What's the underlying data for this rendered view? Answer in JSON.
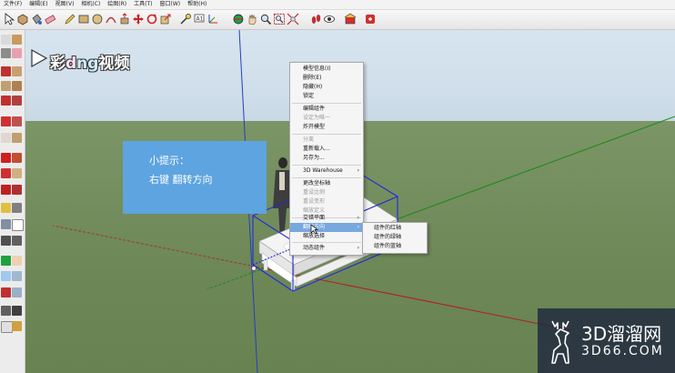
{
  "menubar": {
    "items": [
      "文件(F)",
      "编辑(E)",
      "视图(V)",
      "相机(C)",
      "绘图(R)",
      "工具(T)",
      "窗口(W)",
      "帮助(H)"
    ]
  },
  "logo": {
    "part1": "彩",
    "part2": "d",
    "part3": "ng",
    "part4": "视频"
  },
  "tip": {
    "title": "小提示：",
    "body": "右键  翻转方向",
    "color": "#5ea4e0"
  },
  "context_menu": {
    "items": [
      {
        "label": "模型信息(I)",
        "enabled": true
      },
      {
        "label": "删除(E)",
        "enabled": true
      },
      {
        "label": "隐藏(H)",
        "enabled": true
      },
      {
        "label": "锁定",
        "enabled": true
      },
      {
        "label": "编辑组件",
        "enabled": true
      },
      {
        "label": "设定为唯一",
        "enabled": false
      },
      {
        "label": "炸开模型",
        "enabled": true
      },
      {
        "label": "分离",
        "enabled": false
      },
      {
        "label": "重新载入...",
        "enabled": true
      },
      {
        "label": "另存为...",
        "enabled": true
      },
      {
        "label": "3D Warehouse",
        "enabled": true,
        "submenu": true
      },
      {
        "label": "更改坐标轴",
        "enabled": true
      },
      {
        "label": "重设比例",
        "enabled": false
      },
      {
        "label": "重设变形",
        "enabled": false
      },
      {
        "label": "缩放定义",
        "enabled": false
      },
      {
        "label": "交错平面",
        "enabled": true,
        "submenu": true
      },
      {
        "label": "翻转方向",
        "enabled": true,
        "submenu": true,
        "highlighted": true
      },
      {
        "label": "缩放选择",
        "enabled": true
      },
      {
        "label": "动态组件",
        "enabled": true,
        "submenu": true
      }
    ],
    "submenu_arrow": "›"
  },
  "submenu": {
    "items": [
      "组件的红轴",
      "组件的绿轴",
      "组件的蓝轴"
    ]
  },
  "watermark": {
    "line1": "3D溜溜网",
    "line2": "3D66.COM"
  },
  "colors": {
    "sky": "#cfdeea",
    "ground": "#6d8757",
    "selection": "#1f2bd8",
    "axis_red": "#b02020",
    "axis_green": "#1b8a1b",
    "axis_blue": "#2040c0",
    "menu_highlight": "#79a7df"
  },
  "icons": [
    "select-arrow-icon",
    "paint-bucket-icon",
    "eraser-icon",
    "pencil-icon",
    "rectangle-icon",
    "circle-icon",
    "arc-icon",
    "push-pull-icon",
    "move-icon",
    "rotate-icon",
    "scale-icon",
    "offset-icon",
    "tape-measure-icon",
    "text-icon",
    "protractor-icon",
    "axes-icon",
    "orbit-icon",
    "pan-icon",
    "zoom-icon",
    "zoom-extents-icon",
    "walk-icon",
    "look-around-icon",
    "section-plane-icon",
    "3d-warehouse-icon",
    "extension-warehouse-icon",
    "deer-logo-icon"
  ]
}
